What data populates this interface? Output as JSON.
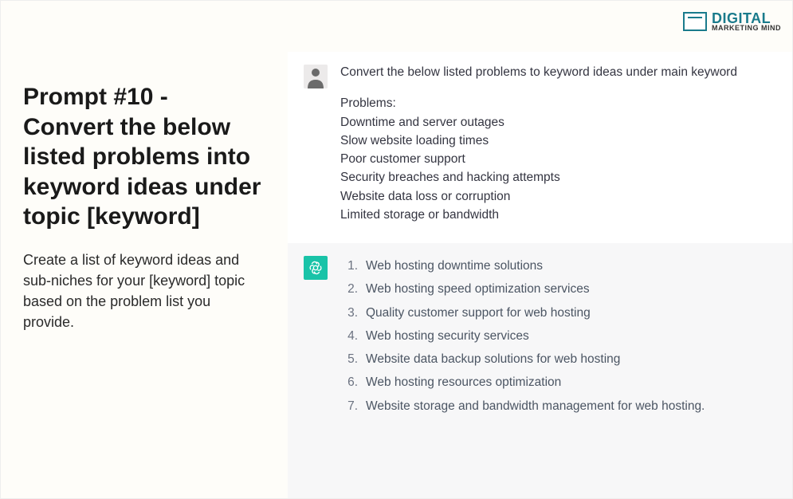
{
  "logo": {
    "line1": "DIGITAL",
    "line2": "MARKETING MIND"
  },
  "left": {
    "title": "Prompt #10 - Convert the below listed problems into keyword ideas under topic [keyword]",
    "description": "Create a list of keyword ideas and sub-niches for your [keyword] topic based on the problem list you provide."
  },
  "chat": {
    "user": {
      "intro": "Convert the below listed problems to keyword ideas under main keyword",
      "problems_label": "Problems:",
      "problems": [
        "Downtime and server outages",
        "Slow website loading times",
        "Poor customer support",
        "Security breaches and hacking attempts",
        "Website data loss or corruption",
        "Limited storage or bandwidth"
      ]
    },
    "bot": {
      "items": [
        "Web hosting downtime solutions",
        "Web hosting speed optimization services",
        "Quality customer support for web hosting",
        "Web hosting security services",
        "Website data backup solutions for web hosting",
        "Web hosting resources optimization",
        "Website storage and bandwidth management for web hosting."
      ]
    }
  }
}
